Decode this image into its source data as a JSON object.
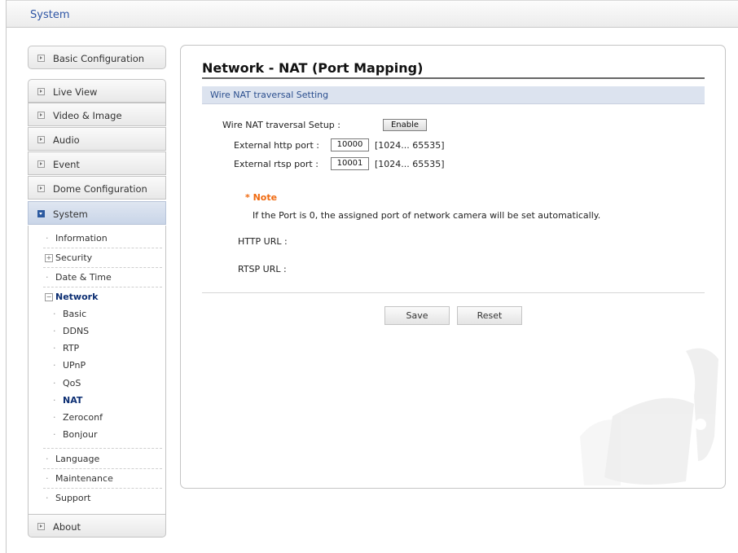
{
  "header": {
    "title": "System"
  },
  "nav": {
    "basic_configuration": "Basic Configuration",
    "live_view": "Live View",
    "video_image": "Video & Image",
    "audio": "Audio",
    "event": "Event",
    "dome_configuration": "Dome Configuration",
    "system": "System",
    "about": "About",
    "system_items": {
      "information": "Information",
      "security": "Security",
      "date_time": "Date & Time",
      "network": "Network",
      "language": "Language",
      "maintenance": "Maintenance",
      "support": "Support"
    },
    "network_items": [
      "Basic",
      "DDNS",
      "RTP",
      "UPnP",
      "QoS",
      "NAT",
      "Zeroconf",
      "Bonjour"
    ],
    "selected": "NAT",
    "icons": {
      "expand": "expand-icon",
      "collapsed_arrow": "arrow-right-icon",
      "expanded_arrow": "arrow-down-icon"
    }
  },
  "main": {
    "title": "Network - NAT (Port Mapping)",
    "section_title": "Wire NAT traversal Setting",
    "setup_label": "Wire NAT traversal Setup :",
    "setup_button": "Enable",
    "http_port_label": "External http port :",
    "http_port_value": "10000",
    "http_port_range": "[1024... 65535]",
    "rtsp_port_label": "External rtsp port :",
    "rtsp_port_value": "10001",
    "rtsp_port_range": "[1024... 65535]",
    "note_title": "* Note",
    "note_text": "If the Port is 0, the assigned port of network camera will be set automatically.",
    "http_url_label": "HTTP URL :",
    "rtsp_url_label": "RTSP URL :",
    "save_label": "Save",
    "reset_label": "Reset"
  },
  "colors": {
    "accent": "#2e55a4",
    "note": "#f06a10",
    "section_bg": "#dce3ef",
    "selected_nav": "#0d2f73"
  }
}
